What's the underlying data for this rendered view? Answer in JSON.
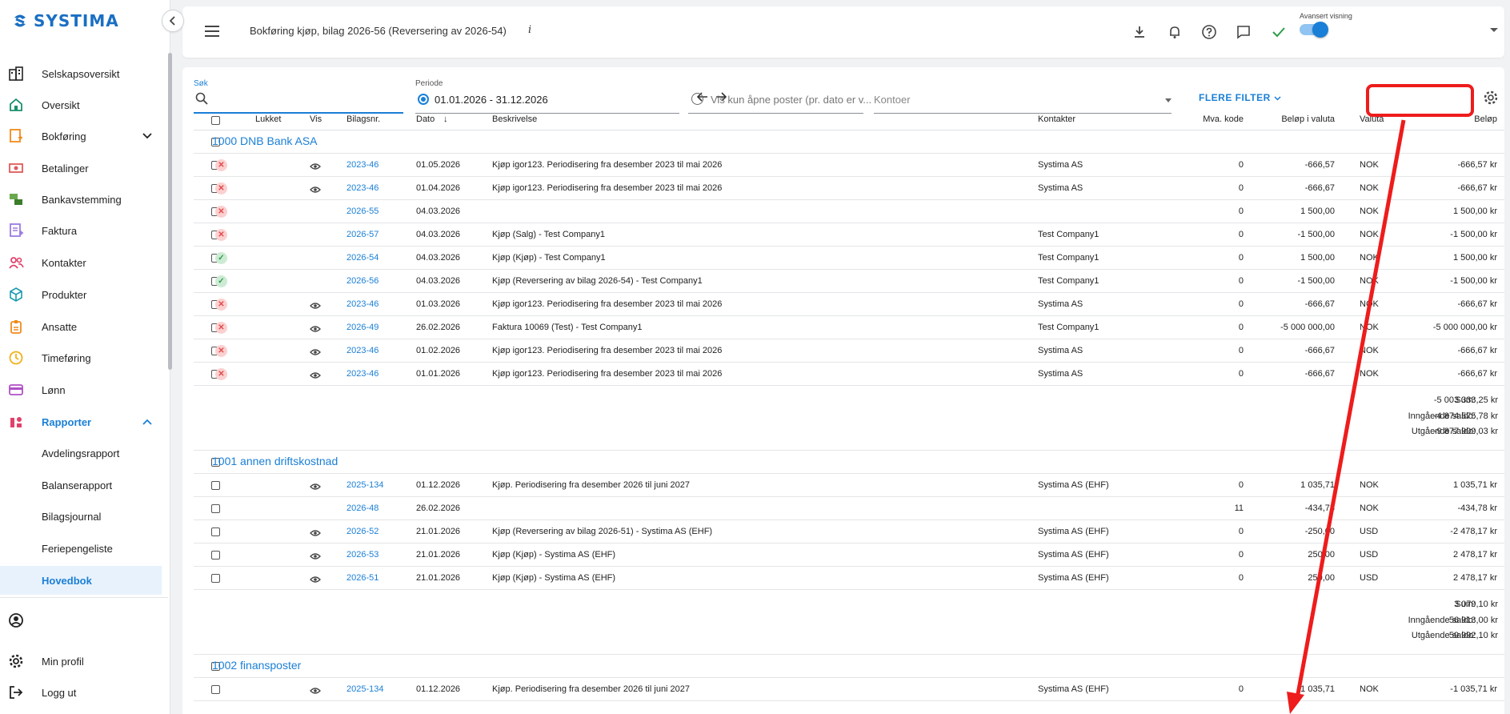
{
  "sidebar": {
    "brand": "SYSTIMA",
    "items": [
      {
        "label": "Selskapsoversikt",
        "icon": "companies-icon"
      },
      {
        "label": "Oversikt",
        "icon": "home-icon"
      },
      {
        "label": "Bokføring",
        "icon": "bookkeeping-icon"
      },
      {
        "label": "Betalinger",
        "icon": "payments-icon"
      },
      {
        "label": "Bankavstemming",
        "icon": "bank-reconciliation-icon"
      },
      {
        "label": "Faktura",
        "icon": "invoice-icon"
      },
      {
        "label": "Kontakter",
        "icon": "contacts-icon"
      },
      {
        "label": "Produkter",
        "icon": "products-icon"
      },
      {
        "label": "Ansatte",
        "icon": "employees-icon"
      },
      {
        "label": "Timeføring",
        "icon": "clock-icon"
      },
      {
        "label": "Lønn",
        "icon": "payroll-icon"
      },
      {
        "label": "Rapporter",
        "icon": "reports-icon"
      }
    ],
    "report_subitems": [
      "Avdelingsrapport",
      "Balanserapport",
      "Bilagsjournal",
      "Feriepengeliste",
      "Hovedbok"
    ],
    "profile": "Min profil",
    "logout": "Logg ut"
  },
  "header": {
    "title": "Bokføring kjøp, bilag 2026-56 (Reversering av 2026-54)",
    "info": "i",
    "advanced_label": "Avansert visning"
  },
  "filters": {
    "search_label": "Søk",
    "period_label": "Periode",
    "period_value": "01.01.2026 - 31.12.2026",
    "open_posts": "Vis kun åpne poster (pr. dato er v...",
    "accounts_placeholder": "Kontoer",
    "more_filters": "FLERE FILTER"
  },
  "table": {
    "columns": [
      "Lukket",
      "Vis",
      "Bilagsnr.",
      "Dato",
      "Beskrivelse",
      "Kontakter",
      "Mva. kode",
      "Beløp i valuta",
      "Valuta",
      "Beløp"
    ],
    "sort_arrow": "↓",
    "sum_labels": {
      "sum": "Sum:",
      "opening": "Inngående saldo:",
      "closing": "Utgående saldo:"
    },
    "groups": [
      {
        "title": "1000 DNB Bank ASA",
        "rows": [
          {
            "status": "x",
            "eye": true,
            "voucher": "2023-46",
            "date": "01.05.2026",
            "desc": "Kjøp igor123. Periodisering fra desember 2023 til mai 2026",
            "contact": "Systima AS",
            "vat": "0",
            "amount_cur": "-666,57",
            "currency": "NOK",
            "amount": "-666,57 kr"
          },
          {
            "status": "x",
            "eye": true,
            "voucher": "2023-46",
            "date": "01.04.2026",
            "desc": "Kjøp igor123. Periodisering fra desember 2023 til mai 2026",
            "contact": "Systima AS",
            "vat": "0",
            "amount_cur": "-666,67",
            "currency": "NOK",
            "amount": "-666,67 kr"
          },
          {
            "status": "x",
            "eye": false,
            "voucher": "2026-55",
            "date": "04.03.2026",
            "desc": "",
            "contact": "",
            "vat": "0",
            "amount_cur": "1 500,00",
            "currency": "NOK",
            "amount": "1 500,00 kr"
          },
          {
            "status": "x",
            "eye": false,
            "voucher": "2026-57",
            "date": "04.03.2026",
            "desc": "Kjøp (Salg) - Test Company1",
            "contact": "Test Company1",
            "vat": "0",
            "amount_cur": "-1 500,00",
            "currency": "NOK",
            "amount": "-1 500,00 kr"
          },
          {
            "status": "ok",
            "eye": false,
            "voucher": "2026-54",
            "date": "04.03.2026",
            "desc": "Kjøp (Kjøp) - Test Company1",
            "contact": "Test Company1",
            "vat": "0",
            "amount_cur": "1 500,00",
            "currency": "NOK",
            "amount": "1 500,00 kr"
          },
          {
            "status": "ok",
            "eye": false,
            "voucher": "2026-56",
            "date": "04.03.2026",
            "desc": "Kjøp (Reversering av bilag 2026-54) - Test Company1",
            "contact": "Test Company1",
            "vat": "0",
            "amount_cur": "-1 500,00",
            "currency": "NOK",
            "amount": "-1 500,00 kr"
          },
          {
            "status": "x",
            "eye": true,
            "voucher": "2023-46",
            "date": "01.03.2026",
            "desc": "Kjøp igor123. Periodisering fra desember 2023 til mai 2026",
            "contact": "Systima AS",
            "vat": "0",
            "amount_cur": "-666,67",
            "currency": "NOK",
            "amount": "-666,67 kr"
          },
          {
            "status": "x",
            "eye": true,
            "voucher": "2026-49",
            "date": "26.02.2026",
            "desc": "Faktura 10069 (Test) - Test Company1",
            "contact": "Test Company1",
            "vat": "0",
            "amount_cur": "-5 000 000,00",
            "currency": "NOK",
            "amount": "-5 000 000,00 kr"
          },
          {
            "status": "x",
            "eye": true,
            "voucher": "2023-46",
            "date": "01.02.2026",
            "desc": "Kjøp igor123. Periodisering fra desember 2023 til mai 2026",
            "contact": "Systima AS",
            "vat": "0",
            "amount_cur": "-666,67",
            "currency": "NOK",
            "amount": "-666,67 kr"
          },
          {
            "status": "x",
            "eye": true,
            "voucher": "2023-46",
            "date": "01.01.2026",
            "desc": "Kjøp igor123. Periodisering fra desember 2023 til mai 2026",
            "contact": "Systima AS",
            "vat": "0",
            "amount_cur": "-666,67",
            "currency": "NOK",
            "amount": "-666,67 kr"
          }
        ],
        "sum": "-5 003 333,25 kr",
        "opening": "-4 874 575,78 kr",
        "closing": "-9 877 909,03 kr"
      },
      {
        "title": "1001 annen driftskostnad",
        "rows": [
          {
            "status": "",
            "eye": true,
            "voucher": "2025-134",
            "date": "01.12.2026",
            "desc": "Kjøp. Periodisering fra desember 2026 til juni 2027",
            "contact": "Systima AS (EHF)",
            "vat": "0",
            "amount_cur": "1 035,71",
            "currency": "NOK",
            "amount": "1 035,71 kr"
          },
          {
            "status": "",
            "eye": false,
            "voucher": "2026-48",
            "date": "26.02.2026",
            "desc": "",
            "contact": "",
            "vat": "11",
            "amount_cur": "-434,78",
            "currency": "NOK",
            "amount": "-434,78 kr"
          },
          {
            "status": "",
            "eye": true,
            "voucher": "2026-52",
            "date": "21.01.2026",
            "desc": "Kjøp (Reversering av bilag 2026-51) - Systima AS (EHF)",
            "contact": "Systima AS (EHF)",
            "vat": "0",
            "amount_cur": "-250,00",
            "currency": "USD",
            "amount": "-2 478,17 kr"
          },
          {
            "status": "",
            "eye": true,
            "voucher": "2026-53",
            "date": "21.01.2026",
            "desc": "Kjøp (Kjøp) - Systima AS (EHF)",
            "contact": "Systima AS (EHF)",
            "vat": "0",
            "amount_cur": "250,00",
            "currency": "USD",
            "amount": "2 478,17 kr"
          },
          {
            "status": "",
            "eye": true,
            "voucher": "2026-51",
            "date": "21.01.2026",
            "desc": "Kjøp (Kjøp) - Systima AS (EHF)",
            "contact": "Systima AS (EHF)",
            "vat": "0",
            "amount_cur": "250,00",
            "currency": "USD",
            "amount": "2 478,17 kr"
          }
        ],
        "sum": "3 079,10 kr",
        "opening": "56 913,00 kr",
        "closing": "59 992,10 kr"
      },
      {
        "title": "1002 finansposter",
        "rows": [
          {
            "status": "",
            "eye": true,
            "voucher": "2025-134",
            "date": "01.12.2026",
            "desc": "Kjøp. Periodisering fra desember 2026 til juni 2027",
            "contact": "Systima AS (EHF)",
            "vat": "0",
            "amount_cur": "-1 035,71",
            "currency": "NOK",
            "amount": "-1 035,71 kr"
          }
        ]
      }
    ]
  },
  "colors": {
    "accent": "#1a7fd6",
    "annotation": "#ee1c1c",
    "closed": "#e24b4b",
    "open": "#2e9d4a"
  }
}
